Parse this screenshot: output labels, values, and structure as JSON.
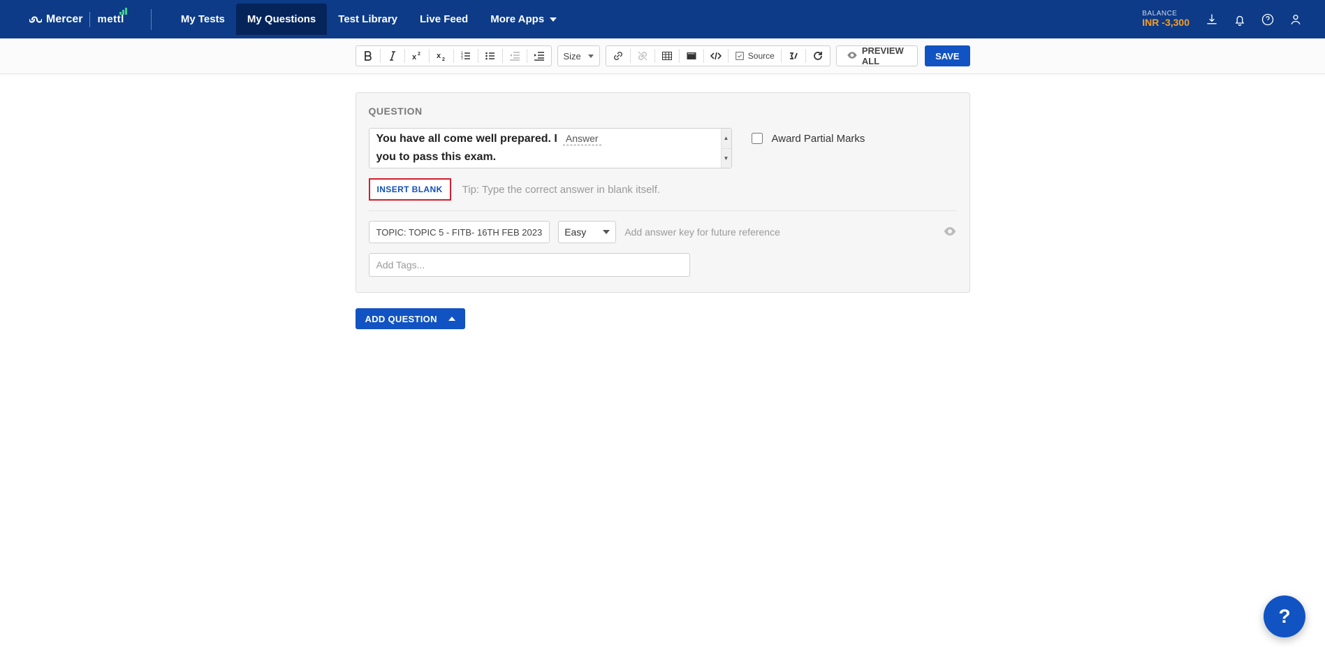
{
  "brand": {
    "name1": "Mercer",
    "name2": "mettl"
  },
  "nav": {
    "items": [
      {
        "label": "My Tests",
        "active": false
      },
      {
        "label": "My Questions",
        "active": true
      },
      {
        "label": "Test Library",
        "active": false
      },
      {
        "label": "Live Feed",
        "active": false
      },
      {
        "label": "More Apps",
        "active": false,
        "dropdown": true
      }
    ]
  },
  "balance": {
    "label": "BALANCE",
    "value": "INR -3,300"
  },
  "toolbar": {
    "size_label": "Size",
    "source_label": "Source",
    "preview_label": "PREVIEW ALL",
    "save_label": "SAVE"
  },
  "question": {
    "heading": "QUESTION",
    "text_before": "You have all come well prepared. I",
    "blank_value": "Answer",
    "text_after": "you to pass this exam.",
    "partial_label": "Award Partial Marks",
    "insert_blank_label": "INSERT BLANK",
    "tip": "Tip: Type the correct answer in blank itself.",
    "topic": "TOPIC: TOPIC 5 - FITB- 16TH FEB 2023",
    "difficulty": "Easy",
    "answer_key_placeholder": "Add answer key for future reference",
    "tags_placeholder": "Add Tags..."
  },
  "add_question_label": "ADD QUESTION",
  "fab_label": "?"
}
